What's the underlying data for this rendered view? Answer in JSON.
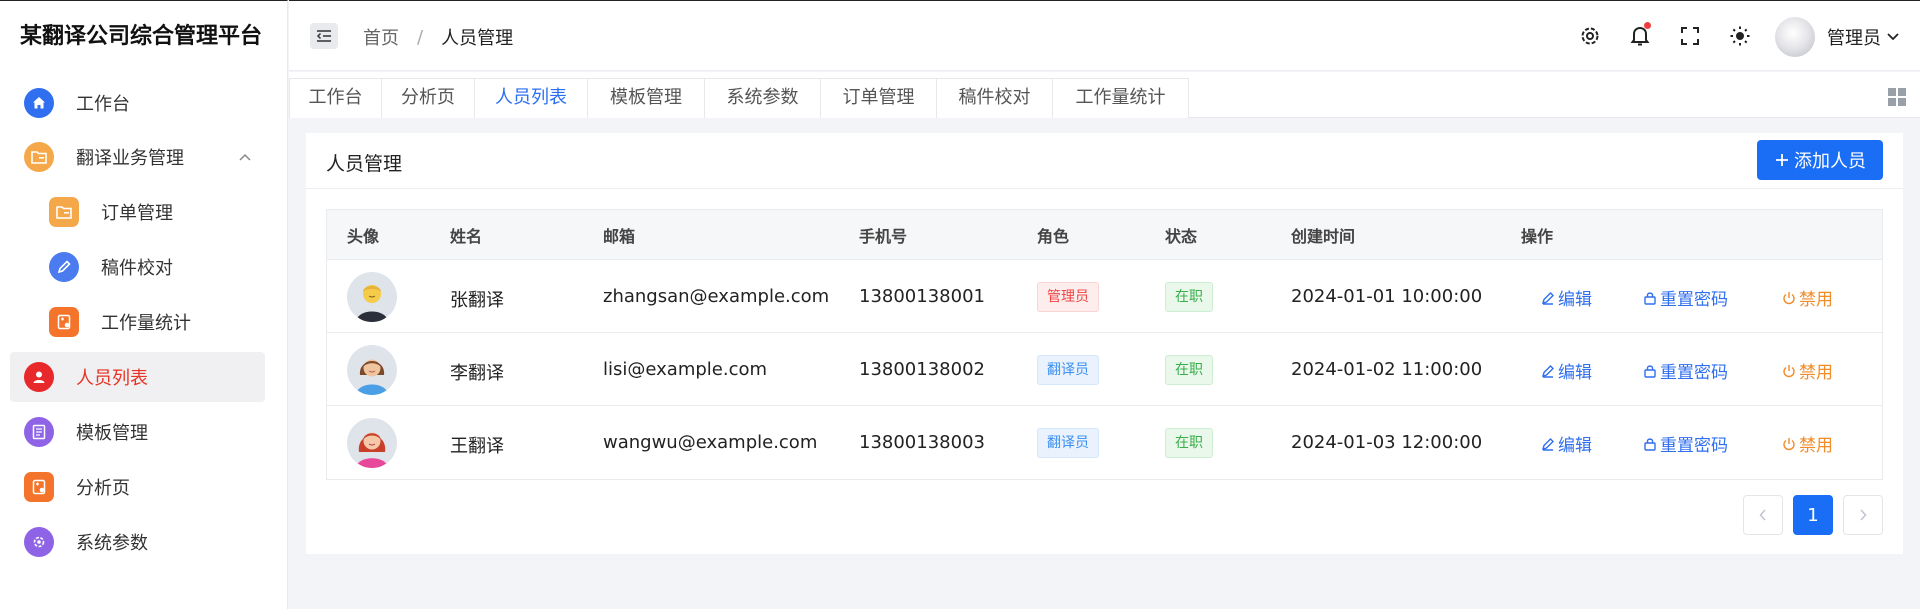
{
  "app": {
    "title": "某翻译公司综合管理平台"
  },
  "sidebar": {
    "items": [
      {
        "label": "工作台",
        "icon": "home-icon",
        "color": "#2f6ff0"
      },
      {
        "label": "翻译业务管理",
        "icon": "folder-icon",
        "color": "#f5a84a"
      },
      {
        "label": "订单管理",
        "icon": "folder-icon",
        "color": "#f5a84a"
      },
      {
        "label": "稿件校对",
        "icon": "edit-icon",
        "color": "#4a7cf0"
      },
      {
        "label": "工作量统计",
        "icon": "calculator-icon",
        "color": "#f3742a"
      },
      {
        "label": "人员列表",
        "icon": "user-icon",
        "color": "#e8292b"
      },
      {
        "label": "模板管理",
        "icon": "template-icon",
        "color": "#8e63e6"
      },
      {
        "label": "分析页",
        "icon": "calculator-icon",
        "color": "#f3742a"
      },
      {
        "label": "系统参数",
        "icon": "settings-icon",
        "color": "#8e63e6"
      }
    ]
  },
  "header": {
    "breadcrumb": {
      "home": "首页",
      "sep": "/",
      "current": "人员管理"
    },
    "user": "管理员"
  },
  "tabs": [
    "工作台",
    "分析页",
    "人员列表",
    "模板管理",
    "系统参数",
    "订单管理",
    "稿件校对",
    "工作量统计"
  ],
  "main": {
    "title": "人员管理",
    "add_button": "添加人员",
    "columns": [
      "头像",
      "姓名",
      "邮箱",
      "手机号",
      "角色",
      "状态",
      "创建时间",
      "操作"
    ],
    "rows": [
      {
        "name": "张翻译",
        "email": "zhangsan@example.com",
        "phone": "13800138001",
        "role": "管理员",
        "status": "在职",
        "created": "2024-01-01 10:00:00"
      },
      {
        "name": "李翻译",
        "email": "lisi@example.com",
        "phone": "13800138002",
        "role": "翻译员",
        "status": "在职",
        "created": "2024-01-02 11:00:00"
      },
      {
        "name": "王翻译",
        "email": "wangwu@example.com",
        "phone": "13800138003",
        "role": "翻译员",
        "status": "在职",
        "created": "2024-01-03 12:00:00"
      }
    ],
    "actions": {
      "edit": "编辑",
      "reset": "重置密码",
      "disable": "禁用"
    },
    "pagination": {
      "current": "1"
    }
  }
}
